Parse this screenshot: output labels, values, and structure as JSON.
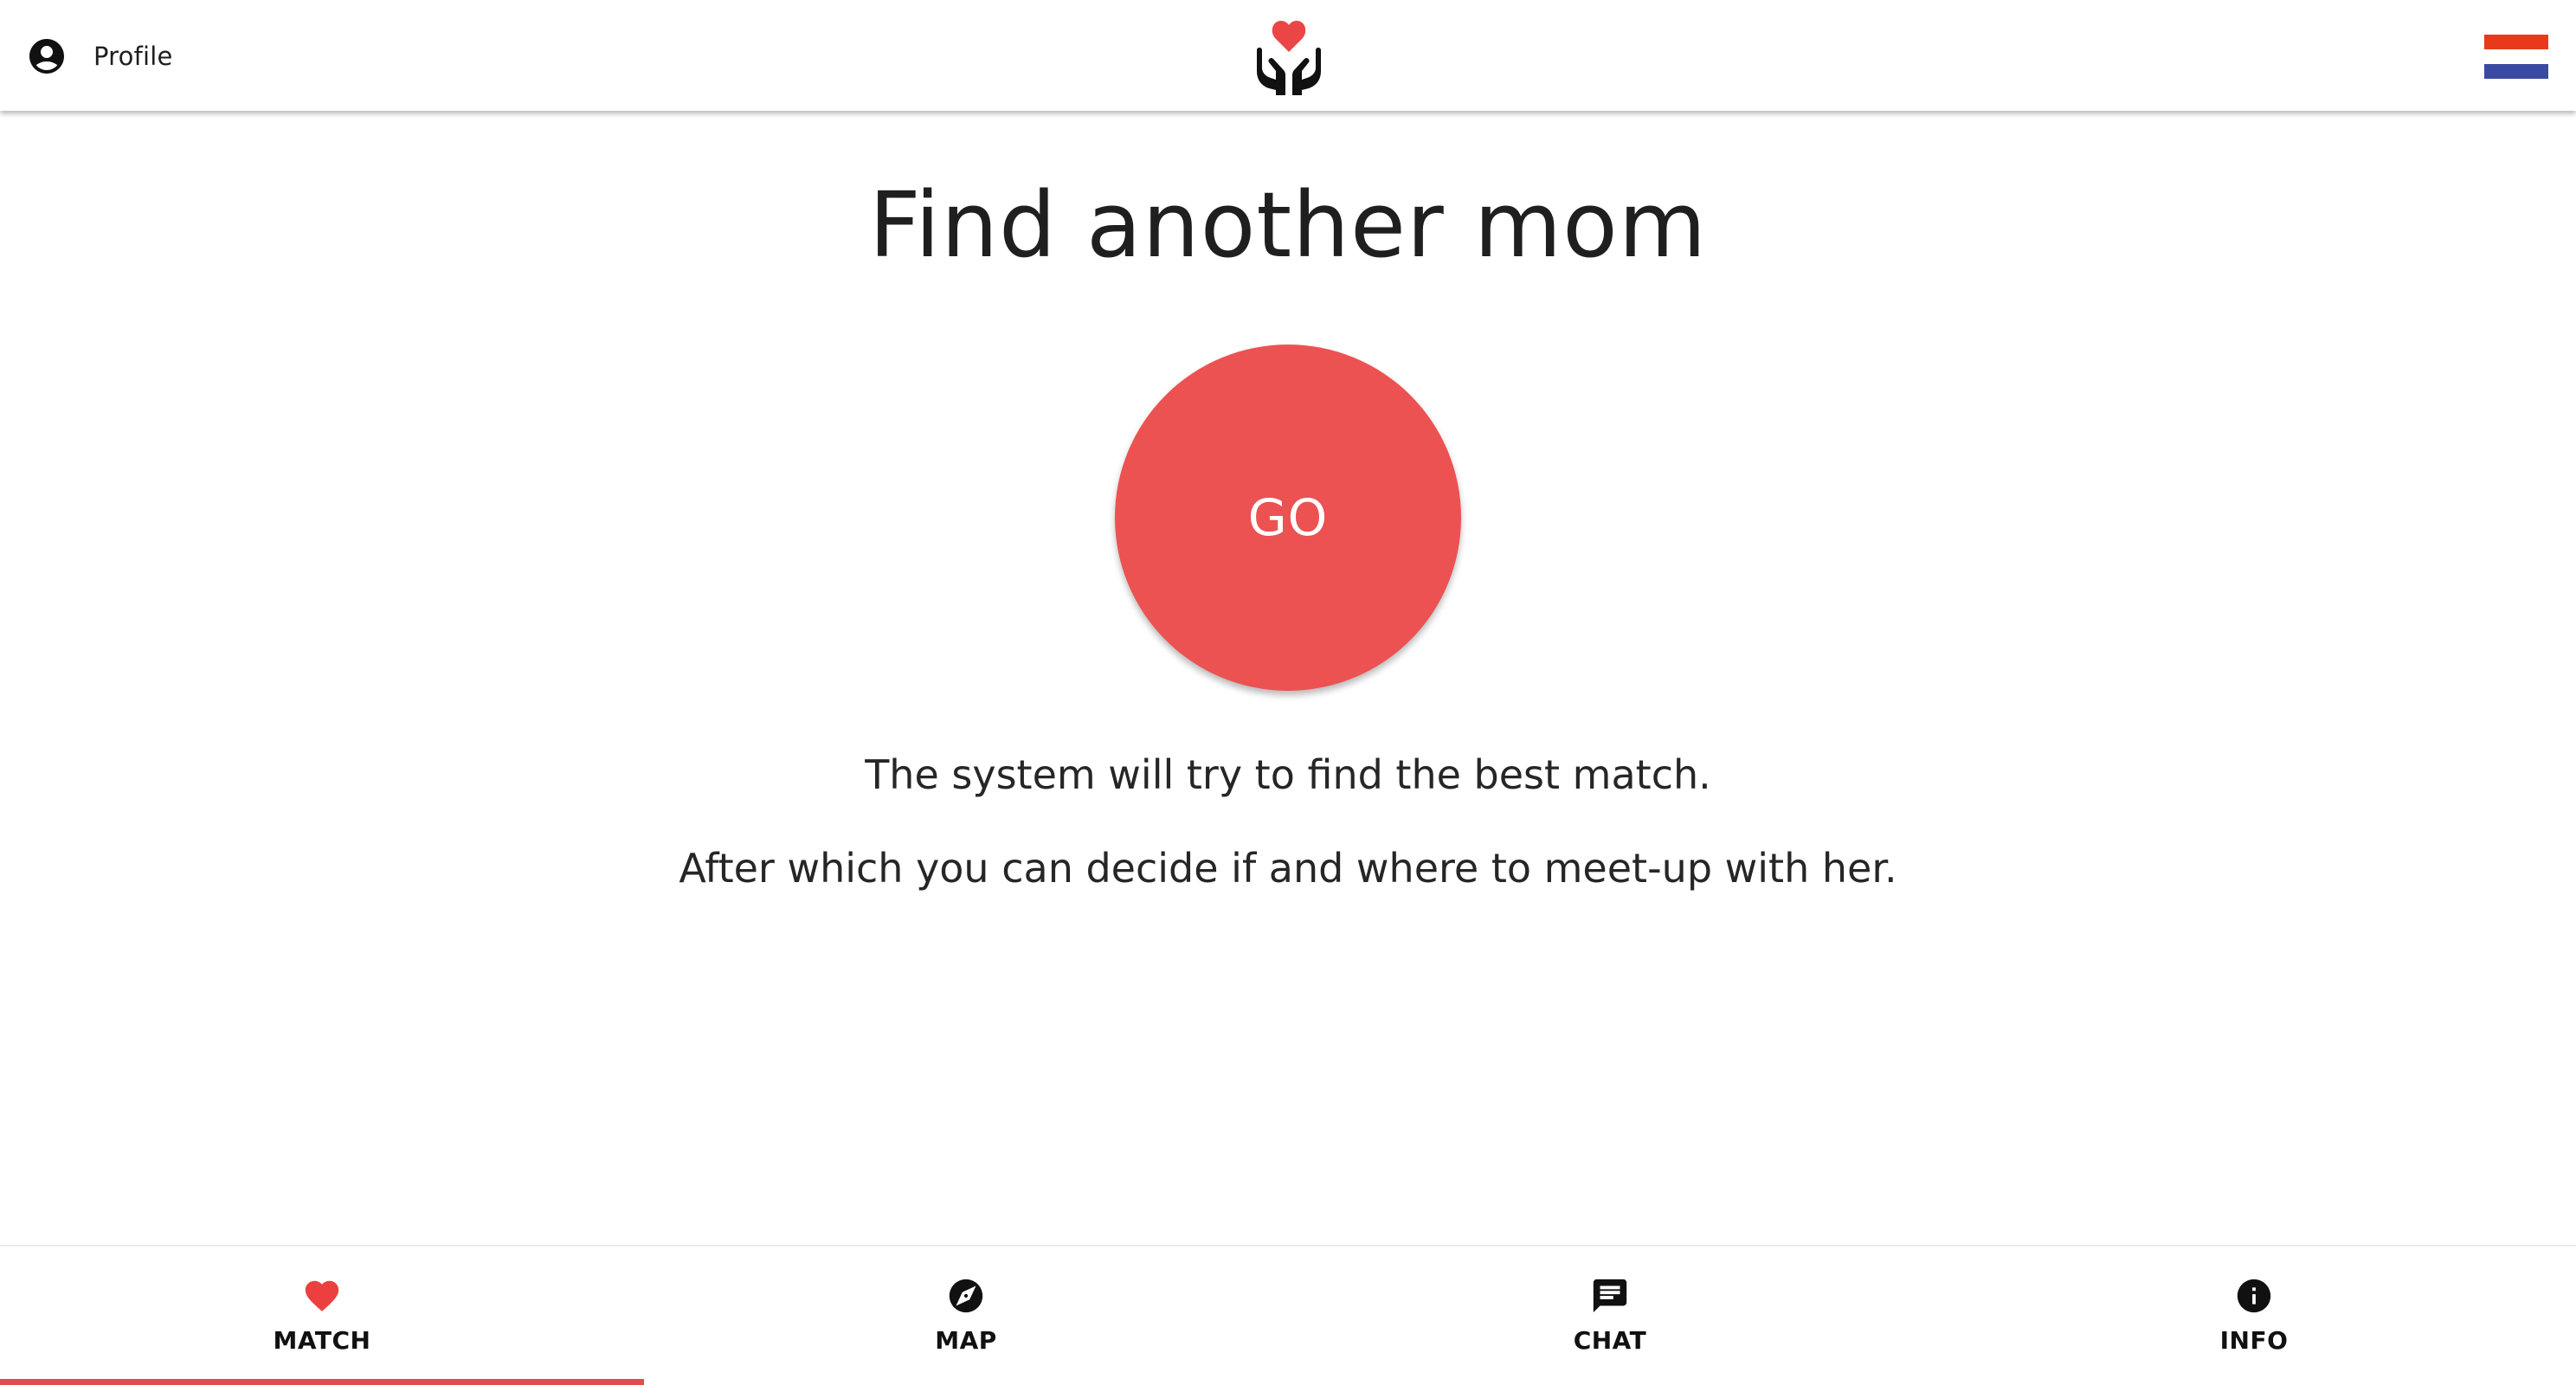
{
  "header": {
    "profile_label": "Profile",
    "profile_icon": "account-circle-icon",
    "logo_icon": "hands-heart-logo",
    "language_icon": "netherlands-flag-icon"
  },
  "main": {
    "title": "Find another mom",
    "go_label": "GO",
    "description_line1": "The system will try to find the best match.",
    "description_line2": "After which you can decide if and where to meet-up with her."
  },
  "bottom_nav": {
    "tabs": [
      {
        "label": "MATCH",
        "icon": "heart-icon",
        "active": true
      },
      {
        "label": "MAP",
        "icon": "compass-icon",
        "active": false
      },
      {
        "label": "CHAT",
        "icon": "chat-icon",
        "active": false
      },
      {
        "label": "INFO",
        "icon": "info-icon",
        "active": false
      }
    ]
  },
  "colors": {
    "accent": "#ec5252",
    "active_tab_indicator": "#e54b4b",
    "flag_red": "#e8391d",
    "flag_white": "#ffffff",
    "flag_blue": "#3a4aa0"
  }
}
